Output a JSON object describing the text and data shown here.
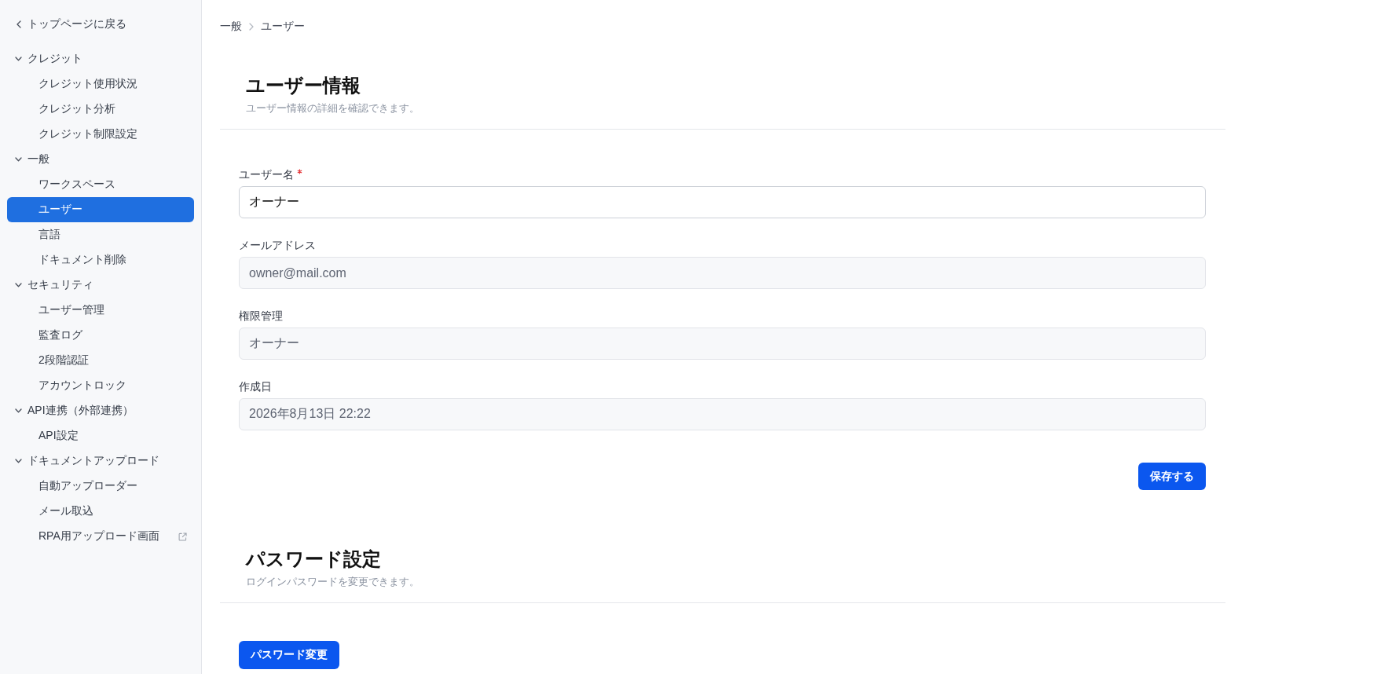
{
  "sidebar": {
    "back_link": {
      "label": "トップページに戻る"
    },
    "groups": [
      {
        "label": "クレジット",
        "expanded": true,
        "items": [
          {
            "label": "クレジット使用状況",
            "selected": false,
            "external": false
          },
          {
            "label": "クレジット分析",
            "selected": false,
            "external": false
          },
          {
            "label": "クレジット制限設定",
            "selected": false,
            "external": false
          }
        ]
      },
      {
        "label": "一般",
        "expanded": true,
        "items": [
          {
            "label": "ワークスペース",
            "selected": false,
            "external": false
          },
          {
            "label": "ユーザー",
            "selected": true,
            "external": false
          },
          {
            "label": "言語",
            "selected": false,
            "external": false
          },
          {
            "label": "ドキュメント削除",
            "selected": false,
            "external": false
          }
        ]
      },
      {
        "label": "セキュリティ",
        "expanded": true,
        "items": [
          {
            "label": "ユーザー管理",
            "selected": false,
            "external": false
          },
          {
            "label": "監査ログ",
            "selected": false,
            "external": false
          },
          {
            "label": "2段階認証",
            "selected": false,
            "external": false
          },
          {
            "label": "アカウントロック",
            "selected": false,
            "external": false
          }
        ]
      },
      {
        "label": "API連携（外部連携）",
        "expanded": true,
        "items": [
          {
            "label": "API設定",
            "selected": false,
            "external": false
          }
        ]
      },
      {
        "label": "ドキュメントアップロード",
        "expanded": true,
        "items": [
          {
            "label": "自動アップローダー",
            "selected": false,
            "external": false
          },
          {
            "label": "メール取込",
            "selected": false,
            "external": false
          },
          {
            "label": "RPA用アップロード画面",
            "selected": false,
            "external": true
          }
        ]
      }
    ]
  },
  "breadcrumb": [
    {
      "label": "一般"
    },
    {
      "label": "ユーザー"
    }
  ],
  "sections": [
    {
      "title": "ユーザー情報",
      "subtitle": "ユーザー情報の詳細を確認できます。",
      "fields": [
        {
          "label": "ユーザー名",
          "required": true,
          "value": "オーナー",
          "disabled": false
        },
        {
          "label": "メールアドレス",
          "required": false,
          "value": "owner@mail.com",
          "disabled": true
        },
        {
          "label": "権限管理",
          "required": false,
          "value": "オーナー",
          "disabled": true
        },
        {
          "label": "作成日",
          "required": false,
          "value": "2026年8月13日 22:22",
          "disabled": true
        }
      ],
      "button": {
        "label": "保存する"
      }
    },
    {
      "title": "パスワード設定",
      "subtitle": "ログインパスワードを変更できます。",
      "button": {
        "label": "パスワード変更"
      }
    }
  ]
}
